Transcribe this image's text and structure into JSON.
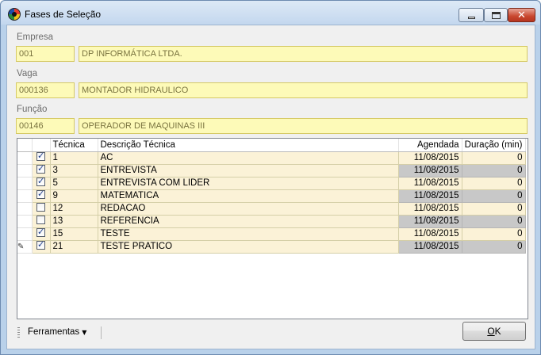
{
  "window": {
    "title": "Fases de Seleção",
    "controls": {
      "minimize_icon": "minimize-icon",
      "maximize_icon": "maximize-icon",
      "close_icon": "close-icon",
      "close_glyph": "✕"
    }
  },
  "empresa": {
    "label": "Empresa",
    "code": "001",
    "name": "DP INFORMÁTICA LTDA."
  },
  "vaga": {
    "label": "Vaga",
    "code": "000136",
    "name": "MONTADOR HIDRAULICO"
  },
  "funcao": {
    "label": "Função",
    "code": "00146",
    "name": "OPERADOR DE MAQUINAS III"
  },
  "grid": {
    "columns": [
      "Técnica",
      "Descrição Técnica",
      "Agendada",
      "Duração (min)"
    ],
    "rows": [
      {
        "checked": true,
        "tecnica": "1",
        "descricao": "AC",
        "agendada": "11/08/2015",
        "duracao": "0"
      },
      {
        "checked": true,
        "tecnica": "3",
        "descricao": "ENTREVISTA",
        "agendada": "11/08/2015",
        "duracao": "0"
      },
      {
        "checked": true,
        "tecnica": "5",
        "descricao": "ENTREVISTA COM LIDER",
        "agendada": "11/08/2015",
        "duracao": "0"
      },
      {
        "checked": true,
        "tecnica": "9",
        "descricao": "MATEMATICA",
        "agendada": "11/08/2015",
        "duracao": "0"
      },
      {
        "checked": false,
        "tecnica": "12",
        "descricao": "REDACAO",
        "agendada": "11/08/2015",
        "duracao": "0"
      },
      {
        "checked": false,
        "tecnica": "13",
        "descricao": "REFERENCIA",
        "agendada": "11/08/2015",
        "duracao": "0"
      },
      {
        "checked": true,
        "tecnica": "15",
        "descricao": "TESTE",
        "agendada": "11/08/2015",
        "duracao": "0"
      },
      {
        "checked": true,
        "tecnica": "21",
        "descricao": "TESTE PRATICO",
        "agendada": "11/08/2015",
        "duracao": "0",
        "editing": true
      }
    ],
    "editing_glyph": "✎"
  },
  "toolbar": {
    "tools_label": "Ferramentas",
    "tools_arrow": "▼"
  },
  "ok_button": {
    "underlined": "O",
    "rest": "K"
  },
  "colors": {
    "field_bg": "#fdfab8",
    "row_bg": "#fbf2d7",
    "alt_gray": "#c8c8c8",
    "window_frame": "#b9d1ea"
  }
}
